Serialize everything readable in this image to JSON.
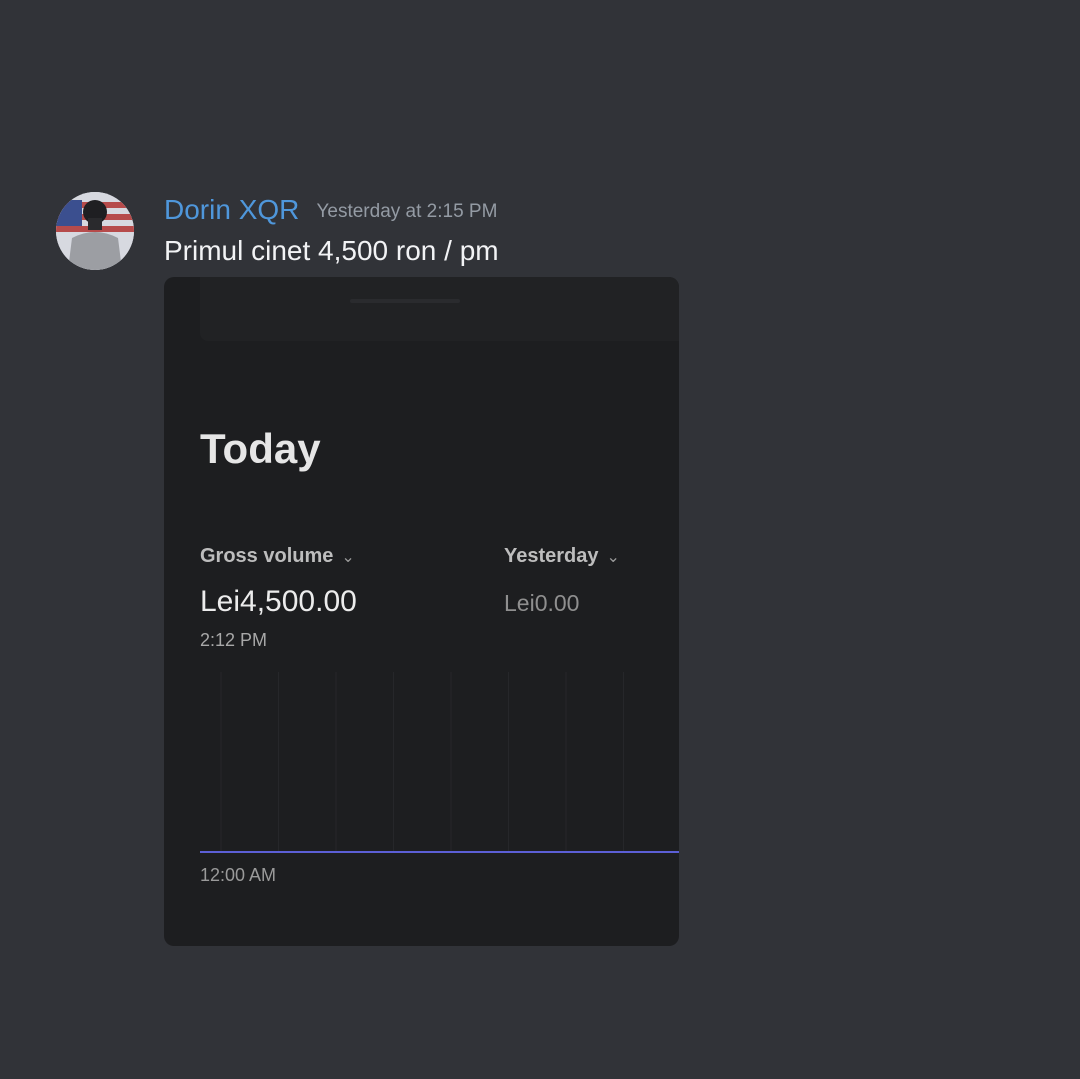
{
  "message": {
    "username": "Dorin XQR",
    "timestamp": "Yesterday at 2:15 PM",
    "text": "Primul cinet 4,500 ron / pm",
    "colors": {
      "username": "#4f97db",
      "background": "#313338"
    }
  },
  "attachment": {
    "title": "Today",
    "metrics": [
      {
        "label": "Gross volume",
        "value": "Lei4,500.00",
        "icon": "chevron-down-icon"
      },
      {
        "label": "Yesterday",
        "value": "Lei0.00",
        "icon": "chevron-down-icon"
      }
    ],
    "current_time": "2:12 PM",
    "colors": {
      "line": "#5c5fd6",
      "card": "#1d1e20"
    }
  },
  "chart_data": {
    "type": "line",
    "x": [
      "12:00 AM",
      "2:12 PM"
    ],
    "series": [
      {
        "values": [
          0,
          0
        ]
      }
    ],
    "xlabel": "",
    "ylabel": "",
    "x_tick_labels": [
      "12:00 AM"
    ],
    "grid": true
  }
}
